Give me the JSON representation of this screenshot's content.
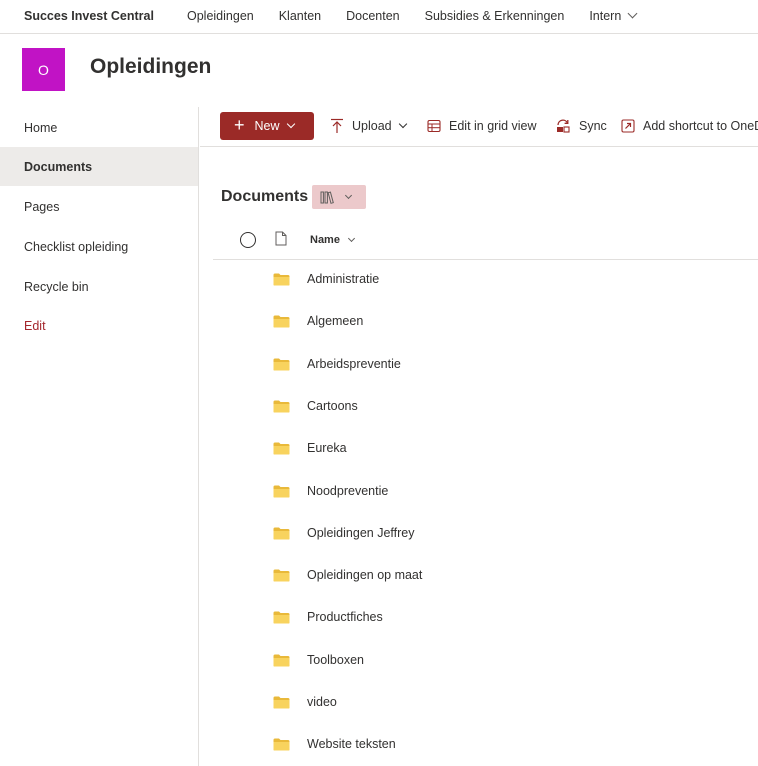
{
  "topnav": {
    "site_name": "Succes Invest Central",
    "items": [
      "Opleidingen",
      "Klanten",
      "Docenten",
      "Subsidies & Erkenningen",
      "Intern"
    ]
  },
  "site": {
    "logo_letter": "O",
    "logo_color": "#c113c5",
    "title": "Opleidingen"
  },
  "leftnav": {
    "items": [
      {
        "label": "Home",
        "active": false
      },
      {
        "label": "Documents",
        "active": true
      },
      {
        "label": "Pages",
        "active": false
      },
      {
        "label": "Checklist opleiding",
        "active": false
      },
      {
        "label": "Recycle bin",
        "active": false
      },
      {
        "label": "Edit",
        "active": false
      }
    ]
  },
  "commandbar": {
    "new_label": "New",
    "upload_label": "Upload",
    "grid_label": "Edit in grid view",
    "sync_label": "Sync",
    "shortcut_label": "Add shortcut to OneDrive"
  },
  "library": {
    "heading": "Documents",
    "column_name": "Name",
    "folders": [
      "Administratie",
      "Algemeen",
      "Arbeidspreventie",
      "Cartoons",
      "Eureka",
      "Noodpreventie",
      "Opleidingen Jeffrey",
      "Opleidingen op maat",
      "Productfiches",
      "Toolboxen",
      "video",
      "Website teksten"
    ]
  },
  "colors": {
    "accent": "#9b2a27",
    "view_button_bg": "#ecc9cb",
    "folder": "#f8d35e"
  }
}
